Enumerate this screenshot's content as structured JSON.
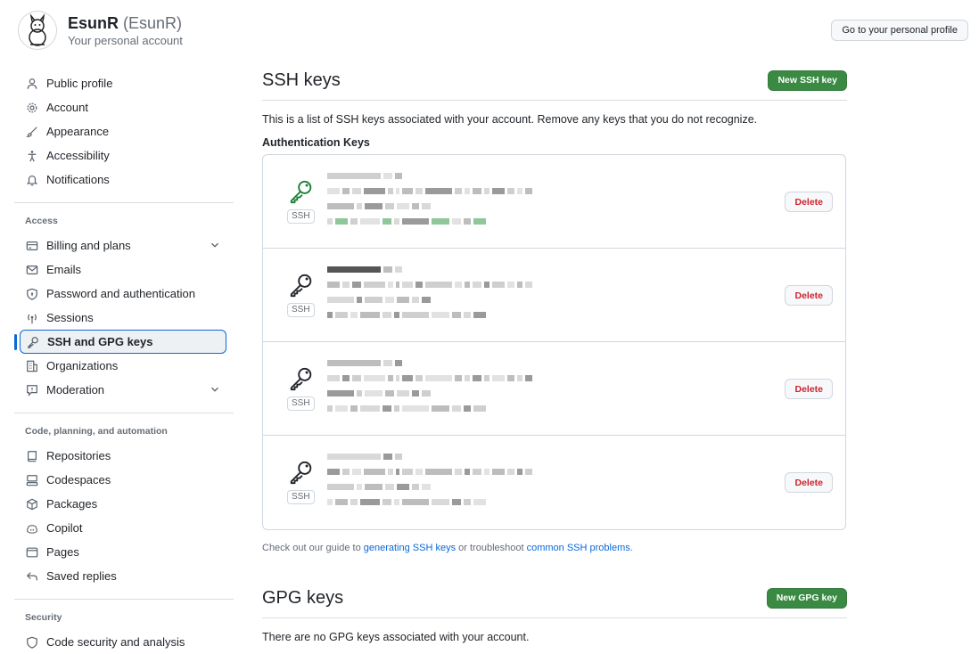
{
  "header": {
    "display_name": "EsunR",
    "handle": "(EsunR)",
    "subtitle": "Your personal account",
    "profile_button": "Go to your personal profile"
  },
  "sidebar": {
    "top_items": [
      {
        "label": "Public profile",
        "icon": "person-icon"
      },
      {
        "label": "Account",
        "icon": "gear-icon"
      },
      {
        "label": "Appearance",
        "icon": "paintbrush-icon"
      },
      {
        "label": "Accessibility",
        "icon": "accessibility-icon"
      },
      {
        "label": "Notifications",
        "icon": "bell-icon"
      }
    ],
    "access_title": "Access",
    "access_items": [
      {
        "label": "Billing and plans",
        "icon": "credit-card-icon"
      },
      {
        "label": "Emails",
        "icon": "mail-icon"
      },
      {
        "label": "Password and authentication",
        "icon": "shield-lock-icon"
      },
      {
        "label": "Sessions",
        "icon": "broadcast-icon"
      },
      {
        "label": "SSH and GPG keys",
        "icon": "key-icon"
      },
      {
        "label": "Organizations",
        "icon": "organization-icon"
      },
      {
        "label": "Moderation",
        "icon": "report-icon"
      }
    ],
    "code_title": "Code, planning, and automation",
    "code_items": [
      {
        "label": "Repositories",
        "icon": "repo-icon"
      },
      {
        "label": "Codespaces",
        "icon": "codespaces-icon"
      },
      {
        "label": "Packages",
        "icon": "package-icon"
      },
      {
        "label": "Copilot",
        "icon": "copilot-icon"
      },
      {
        "label": "Pages",
        "icon": "browser-icon"
      },
      {
        "label": "Saved replies",
        "icon": "reply-icon"
      }
    ],
    "security_title": "Security",
    "security_items": [
      {
        "label": "Code security and analysis",
        "icon": "shield-icon"
      }
    ]
  },
  "ssh": {
    "title": "SSH keys",
    "new_button": "New SSH key",
    "intro": "This is a list of SSH keys associated with your account. Remove any keys that you do not recognize.",
    "auth_title": "Authentication Keys",
    "keys": [
      {
        "type_label": "SSH",
        "delete_label": "Delete",
        "recently_used": true
      },
      {
        "type_label": "SSH",
        "delete_label": "Delete",
        "recently_used": false
      },
      {
        "type_label": "SSH",
        "delete_label": "Delete",
        "recently_used": false
      },
      {
        "type_label": "SSH",
        "delete_label": "Delete",
        "recently_used": false
      }
    ],
    "guide_prefix": "Check out our guide to",
    "guide_link1": "generating SSH keys",
    "guide_middle": "or troubleshoot",
    "guide_link2": "common SSH problems",
    "guide_suffix": "."
  },
  "gpg": {
    "title": "GPG keys",
    "new_button": "New GPG key",
    "empty": "There are no GPG keys associated with your account."
  },
  "colors": {
    "accent": "#0969da",
    "primary_button": "#3a8a43",
    "danger": "#cf222e",
    "active_key": "#1a7f37"
  }
}
